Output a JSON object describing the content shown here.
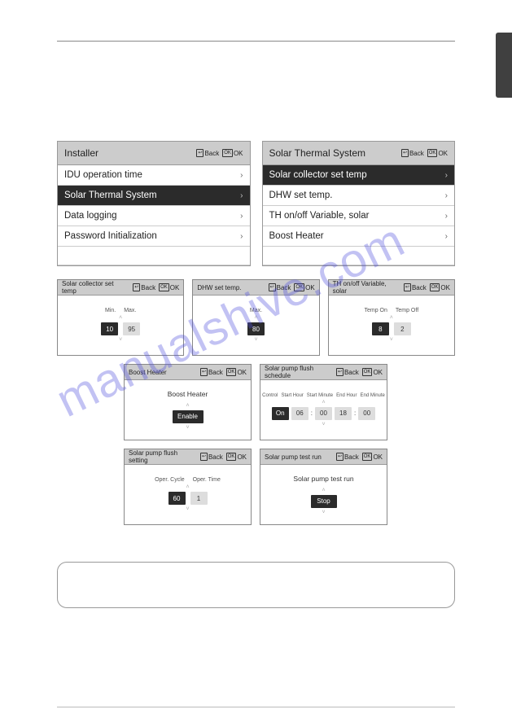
{
  "nav": {
    "back": "Back",
    "ok": "OK",
    "back_icon": "↩",
    "ok_icon": "OK"
  },
  "installer": {
    "title": "Installer",
    "items": [
      {
        "label": "IDU operation time",
        "sel": false
      },
      {
        "label": "Solar Thermal System",
        "sel": true
      },
      {
        "label": "Data logging",
        "sel": false
      },
      {
        "label": "Password Initialization",
        "sel": false
      }
    ]
  },
  "solar": {
    "title": "Solar Thermal System",
    "items": [
      {
        "label": "Solar collector set temp",
        "sel": true
      },
      {
        "label": "DHW set temp.",
        "sel": false
      },
      {
        "label": "TH on/off Variable, solar",
        "sel": false
      },
      {
        "label": "Boost Heater",
        "sel": false
      }
    ]
  },
  "d_collector": {
    "title": "Solar collector set temp",
    "labels": [
      "Min.",
      "Max."
    ],
    "vals": [
      "10",
      "95"
    ]
  },
  "d_dhw": {
    "title": "DHW set temp.",
    "labels": [
      "Max."
    ],
    "vals": [
      "80"
    ]
  },
  "d_th": {
    "title": "TH on/off Variable, solar",
    "labels": [
      "Temp On",
      "Temp Off"
    ],
    "vals": [
      "8",
      "2"
    ]
  },
  "d_boost": {
    "title": "Boost Heater",
    "sublabel": "Boost Heater",
    "val": "Enable"
  },
  "d_schedule": {
    "title": "Solar pump flush schedule",
    "labels": [
      "Control",
      "Start Hour",
      "Start Minute",
      "End Hour",
      "End Minute"
    ],
    "vals": [
      "On",
      "06",
      "00",
      "18",
      "00"
    ]
  },
  "d_flush": {
    "title": "Solar pump flush setting",
    "labels": [
      "Oper. Cycle",
      "Oper. Time"
    ],
    "vals": [
      "60",
      "1"
    ]
  },
  "d_test": {
    "title": "Solar pump test run",
    "sublabel": "Solar pump test run",
    "val": "Stop"
  },
  "watermark": "manualshive.com"
}
